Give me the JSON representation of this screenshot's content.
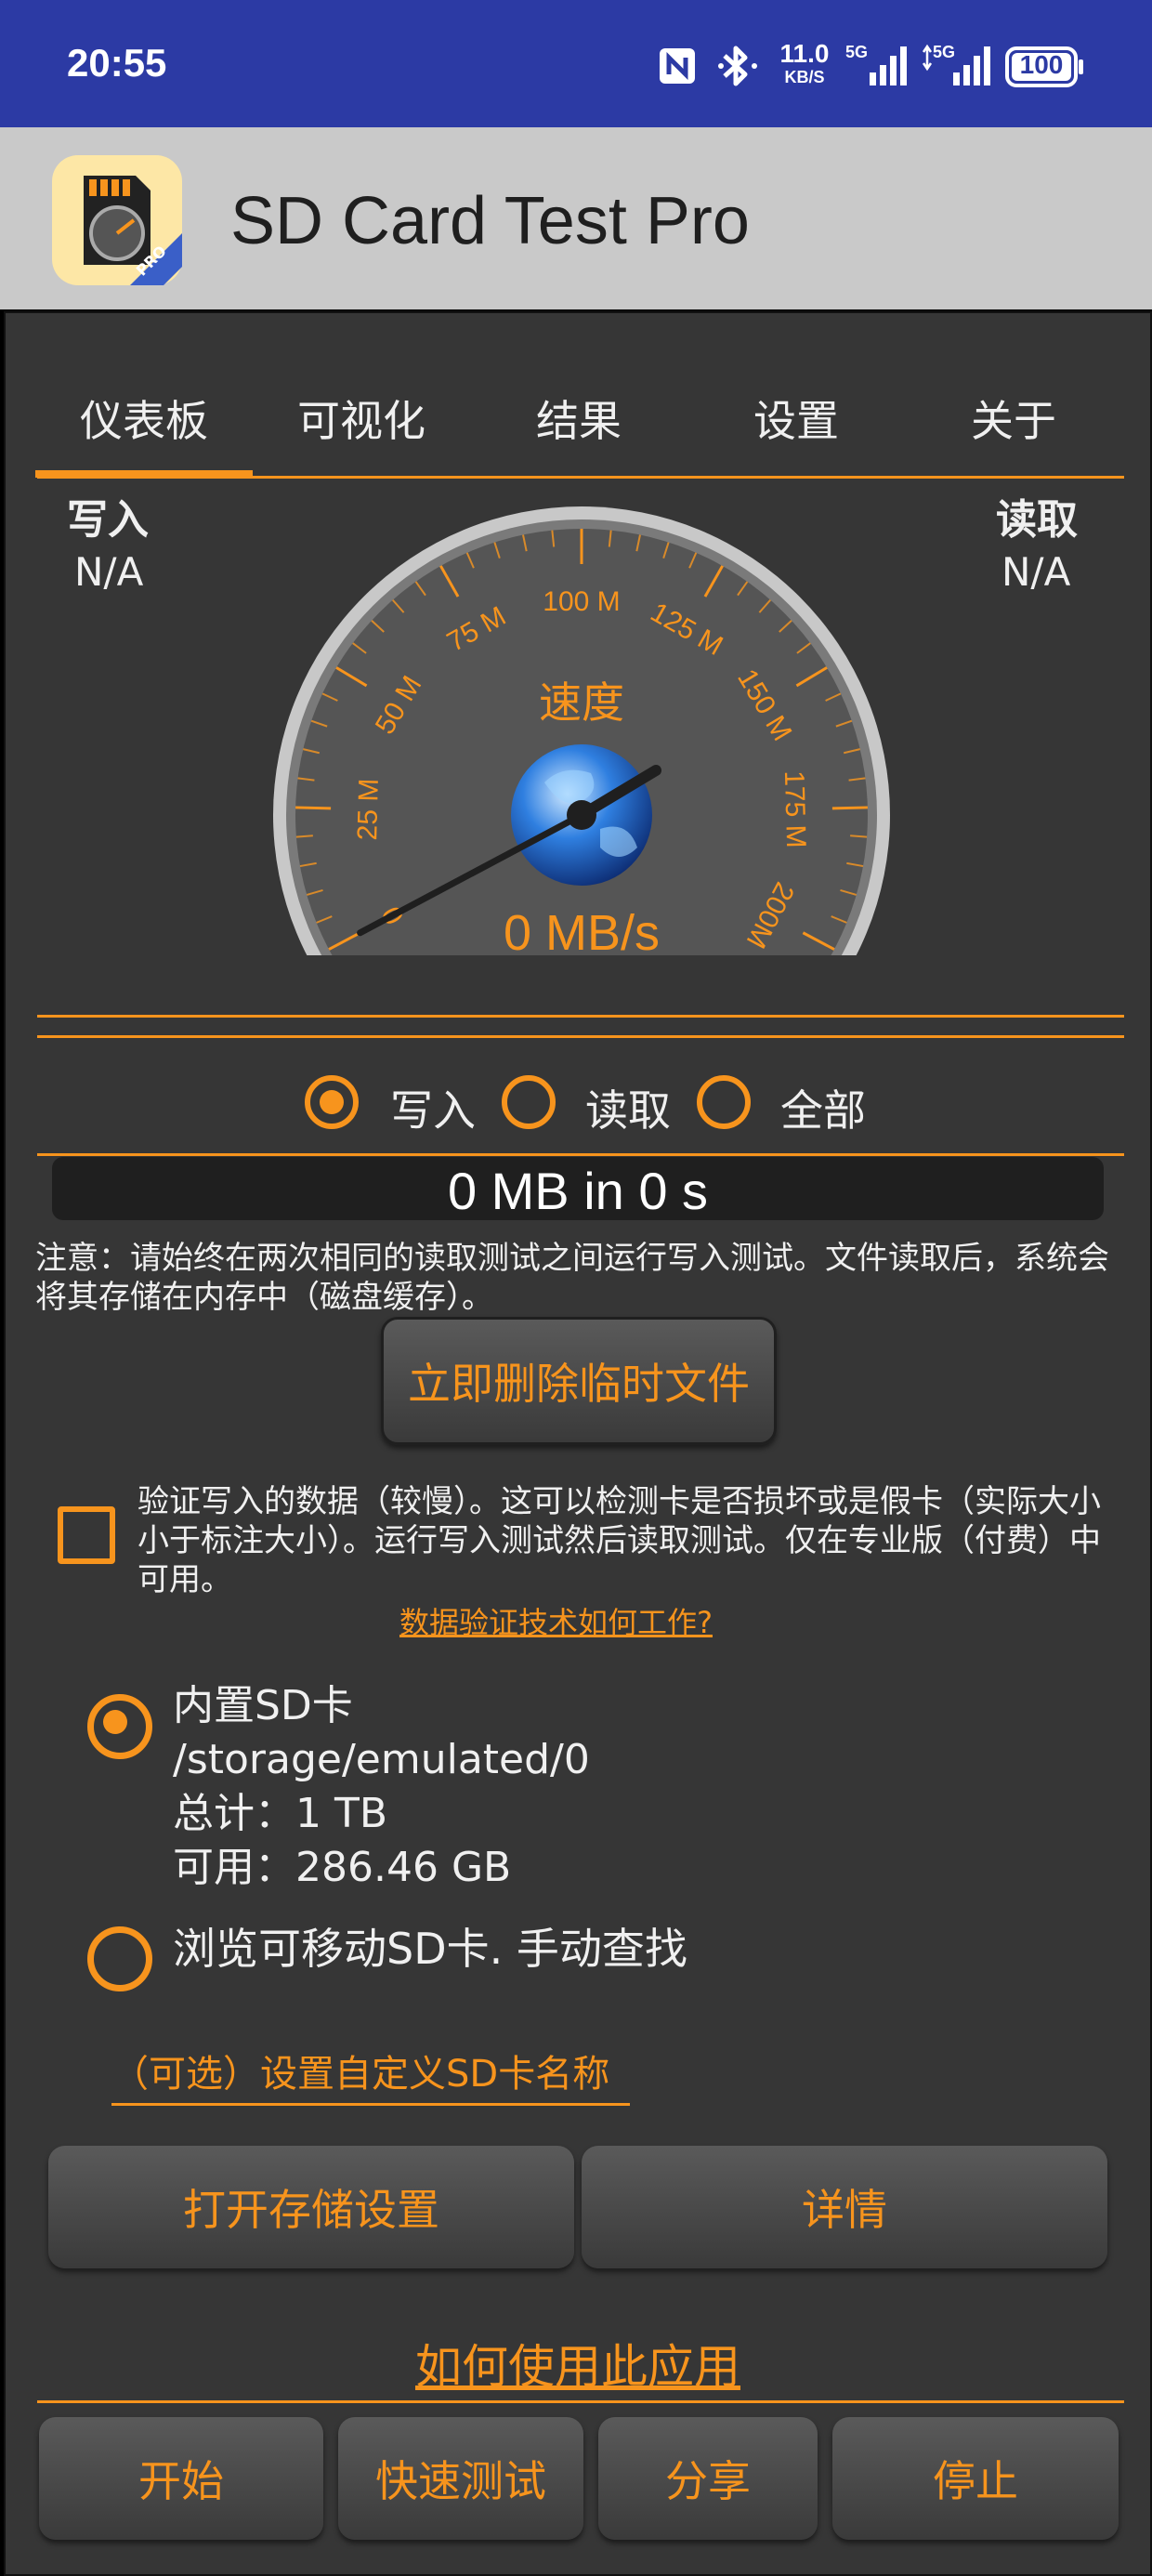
{
  "status_bar": {
    "time": "20:55",
    "network_speed": "11.0",
    "network_speed_unit": "KB/S",
    "signal1_label": "5G",
    "signal2_label": "5G",
    "battery": "100",
    "icons": [
      "nfc-icon",
      "bluetooth-icon",
      "signal-icon",
      "battery-icon"
    ]
  },
  "app_bar": {
    "title": "SD Card Test Pro",
    "icon_badge": "PRO"
  },
  "tabs": [
    {
      "label": "仪表板",
      "selected": true
    },
    {
      "label": "可视化",
      "selected": false
    },
    {
      "label": "结果",
      "selected": false
    },
    {
      "label": "设置",
      "selected": false
    },
    {
      "label": "关于",
      "selected": false
    }
  ],
  "gauge": {
    "write_label": "写入",
    "write_value": "N/A",
    "read_label": "读取",
    "read_value": "N/A",
    "title": "速度",
    "speed_text": "0 MB/s",
    "ticks": [
      "0",
      "25 M",
      "50 M",
      "75 M",
      "100 M",
      "125 M",
      "150 M",
      "175 M",
      "200M"
    ],
    "needle_value": 0,
    "max": 200
  },
  "mode": {
    "options": [
      {
        "label": "写入",
        "selected": true
      },
      {
        "label": "读取",
        "selected": false
      },
      {
        "label": "全部",
        "selected": false
      }
    ]
  },
  "progress": {
    "text": "0 MB in 0 s"
  },
  "note": "注意：请始终在两次相同的读取测试之间运行写入测试。文件读取后，系统会将其存储在内存中（磁盘缓存）。",
  "delete_button": "立即删除临时文件",
  "verify": {
    "checked": false,
    "text": "验证写入的数据（较慢）。这可以检测卡是否损坏或是假卡（实际大小小于标注大小）。运行写入测试然后读取测试。仅在专业版（付费）中可用。",
    "link": "数据验证技术如何工作?"
  },
  "storage": {
    "internal": {
      "name": "内置SD卡",
      "path": "/storage/emulated/0",
      "total": "总计：1 TB",
      "free": "可用：286.46 GB",
      "selected": true
    },
    "browse": {
      "label": "浏览可移动SD卡. 手动查找",
      "selected": false
    },
    "custom_name_link": "（可选）设置自定义SD卡名称"
  },
  "buttons": {
    "open_storage": "打开存储设置",
    "details": "详情",
    "how_to": "如何使用此应用",
    "start": "开始",
    "quick_test": "快速测试",
    "share": "分享",
    "stop": "停止"
  },
  "colors": {
    "accent": "#f7941d",
    "background": "#363636",
    "status_bar": "#2c3aa4",
    "app_bar": "#c9c9c9"
  }
}
